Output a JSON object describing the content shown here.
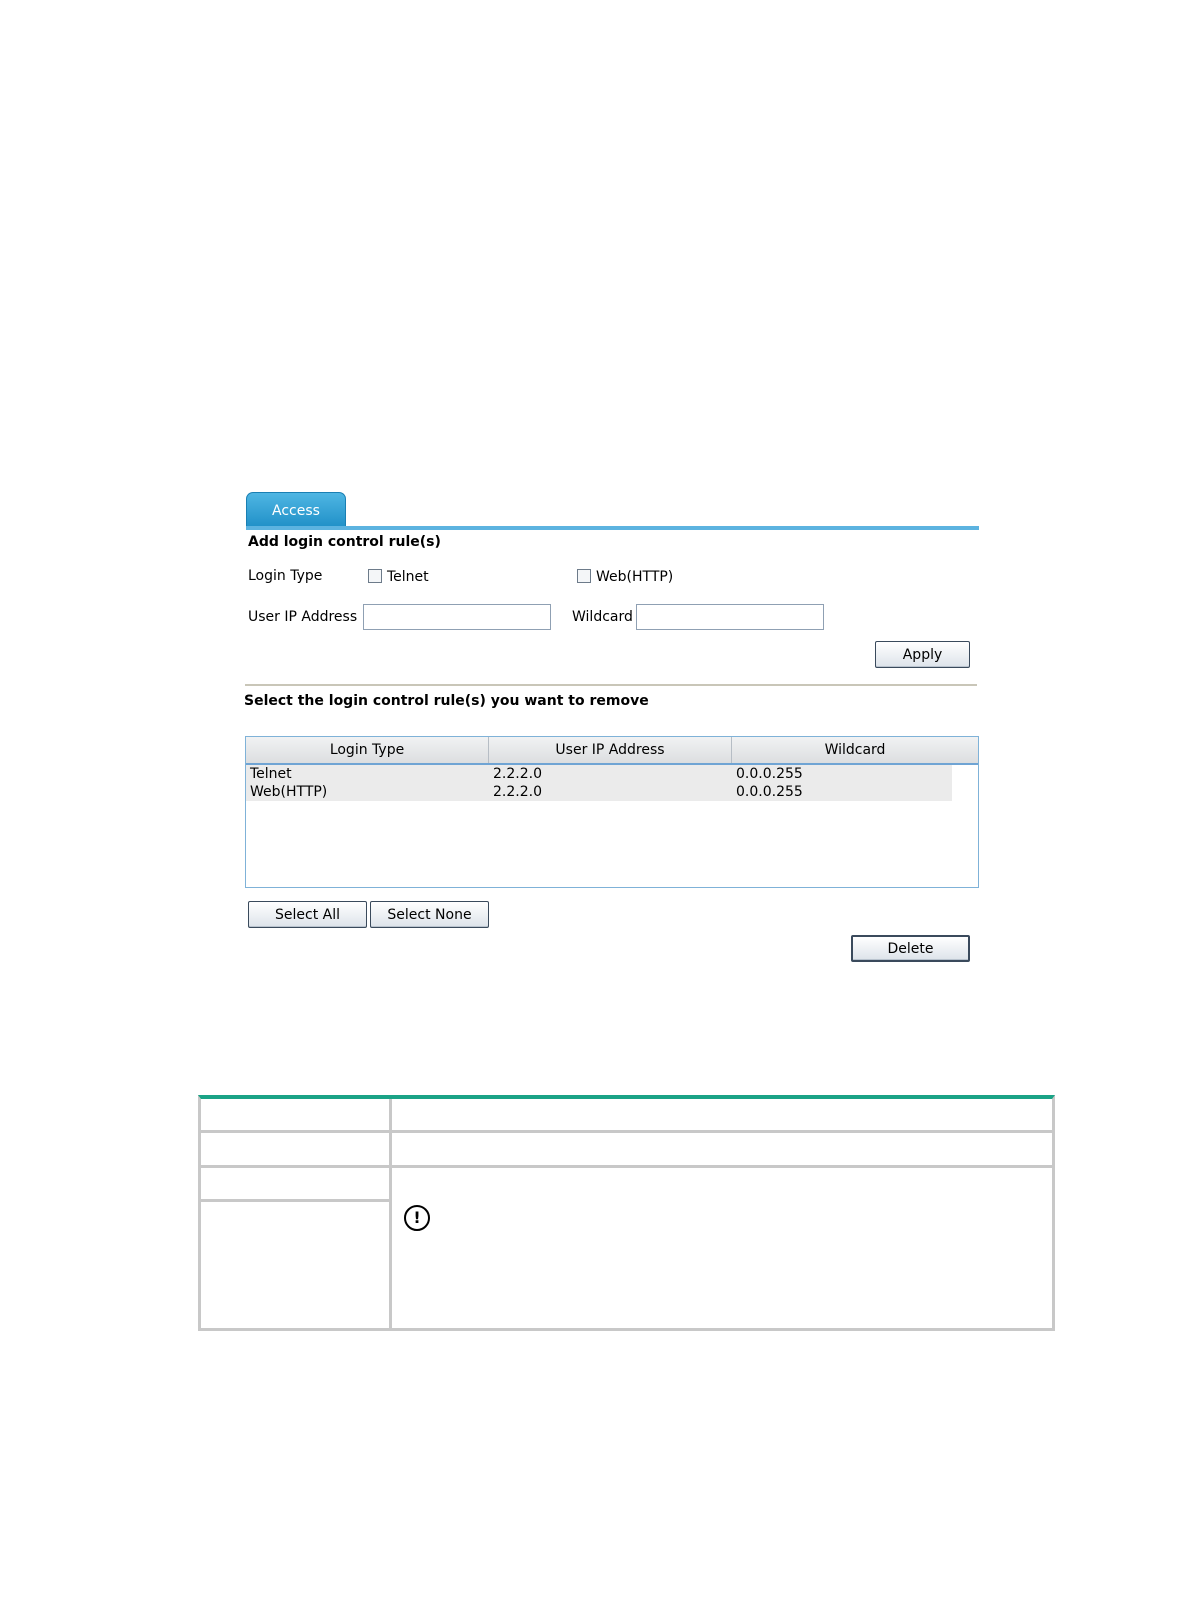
{
  "tab": {
    "label": "Access"
  },
  "add_section": {
    "title": "Add login control rule(s)",
    "login_type_label": "Login Type",
    "telnet_label": "Telnet",
    "web_label": "Web(HTTP)",
    "user_ip_label": "User IP Address",
    "user_ip_value": "",
    "wildcard_label": "Wildcard",
    "wildcard_value": "",
    "apply_label": "Apply"
  },
  "remove_section": {
    "title": "Select the login control rule(s) you want to remove",
    "columns": [
      "Login Type",
      "User IP Address",
      "Wildcard"
    ],
    "rows": [
      {
        "login_type": "Telnet",
        "ip": "2.2.2.0",
        "wildcard": "0.0.0.255"
      },
      {
        "login_type": "Web(HTTP)",
        "ip": "2.2.2.0",
        "wildcard": "0.0.0.255"
      }
    ],
    "select_all_label": "Select All",
    "select_none_label": "Select None",
    "delete_label": "Delete"
  },
  "doc_table": {
    "warning_icon": "exclamation-circle-icon"
  }
}
